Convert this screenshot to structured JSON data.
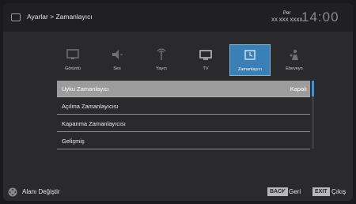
{
  "header": {
    "breadcrumb": "Ayarlar > Zamanlayıcı",
    "day": "Per",
    "date": "XX XXX XXXX",
    "time": "14:00"
  },
  "tabs": [
    {
      "label": "Görüntü",
      "icon": "picture-icon"
    },
    {
      "label": "Ses",
      "icon": "speaker-icon"
    },
    {
      "label": "Yayın",
      "icon": "antenna-icon"
    },
    {
      "label": "TV",
      "icon": "tv-icon"
    },
    {
      "label": "Zamanlayıcı",
      "icon": "timer-icon",
      "active": true
    },
    {
      "label": "Ebeveyn",
      "icon": "parental-icon"
    }
  ],
  "menu": [
    {
      "label": "Uyku Zamanlayıcı",
      "value": "Kapalı",
      "selected": true
    },
    {
      "label": "Açılma Zamanlayıcısı",
      "value": ""
    },
    {
      "label": "Kapanma Zamanlayıcısı",
      "value": ""
    },
    {
      "label": "Gelişmiş",
      "value": ""
    }
  ],
  "footer": {
    "nav_hint": "Alanı Değiştir",
    "back_key": "BACK",
    "back_label": "Geri",
    "exit_key": "EXIT",
    "exit_label": "Çıkış"
  },
  "colors": {
    "accent": "#3a7fb5",
    "selected_row": "#9c9c9c",
    "background": "#2a2a2d"
  }
}
